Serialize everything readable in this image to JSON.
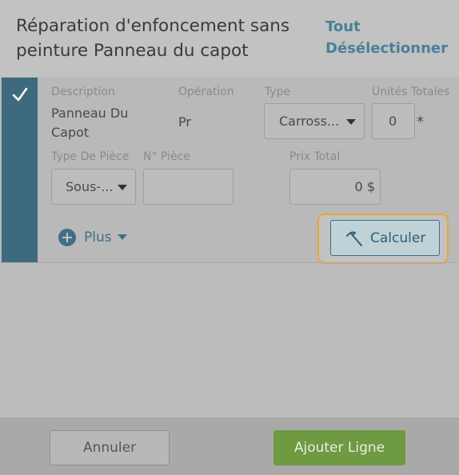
{
  "header": {
    "title": "Réparation d'enfoncement sans peinture Panneau du capot",
    "deselect_all": "Tout Désélectionner"
  },
  "line_item": {
    "selected": true,
    "labels": {
      "description": "Description",
      "operation": "Opération",
      "type": "Type",
      "total_units": "Unités Totales",
      "part_type": "Type De Pièce",
      "part_number": "N° Pièce",
      "total_price": "Prix Total"
    },
    "values": {
      "description": "Panneau Du Capot",
      "operation": "Pr",
      "type": "Carross...",
      "total_units": "0",
      "total_units_marker": "*",
      "part_type": "Sous-...",
      "part_number": "",
      "total_price": "0 $"
    },
    "more_label": "Plus",
    "calculate_label": "Calculer"
  },
  "footer": {
    "cancel_label": "Annuler",
    "add_line_label": "Ajouter Ligne"
  },
  "colors": {
    "accent": "#3f6f87",
    "focus_ring": "#e8a53a",
    "primary_button": "#6e9a42",
    "check_bar": "#3d6a7c"
  },
  "icons": {
    "check": "check-icon",
    "plus": "plus-circle-icon",
    "caret": "caret-down-icon",
    "calculate": "hammer-icon"
  }
}
